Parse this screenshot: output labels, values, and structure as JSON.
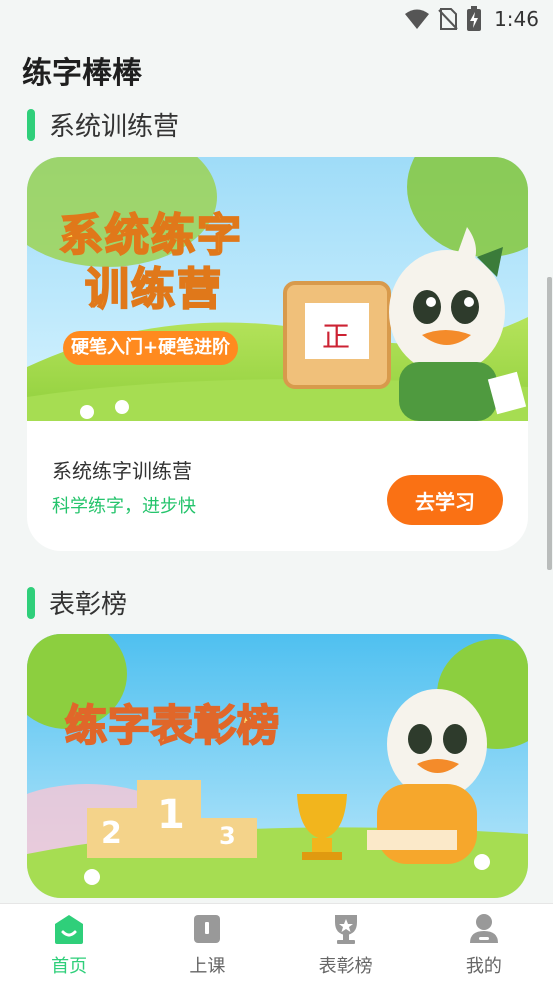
{
  "status_bar": {
    "time": "1:46",
    "icons": [
      "wifi-icon",
      "no-sim-icon",
      "battery-charging-icon"
    ]
  },
  "app": {
    "title": "练字棒棒"
  },
  "sections": [
    {
      "title": "系统训练营",
      "card": {
        "banner": {
          "headline_line1": "系统练字",
          "headline_line2": "训练营",
          "tag": "硬笔入门+硬笔进阶",
          "board_char": "正"
        },
        "title": "系统练字训练营",
        "subtitle": "科学练字，进步快",
        "button_label": "去学习"
      }
    },
    {
      "title": "表彰榜",
      "card": {
        "banner": {
          "headline": "练字表彰榜",
          "podium": [
            "2",
            "1",
            "3"
          ]
        }
      }
    }
  ],
  "bottom_nav": {
    "items": [
      {
        "label": "首页",
        "icon": "home-icon",
        "active": true
      },
      {
        "label": "上课",
        "icon": "book-icon",
        "active": false
      },
      {
        "label": "表彰榜",
        "icon": "trophy-icon",
        "active": false
      },
      {
        "label": "我的",
        "icon": "profile-icon",
        "active": false
      }
    ]
  },
  "colors": {
    "accent_green": "#2fcf7a",
    "button_orange": "#fa7114",
    "background": "#f3f6f5"
  }
}
